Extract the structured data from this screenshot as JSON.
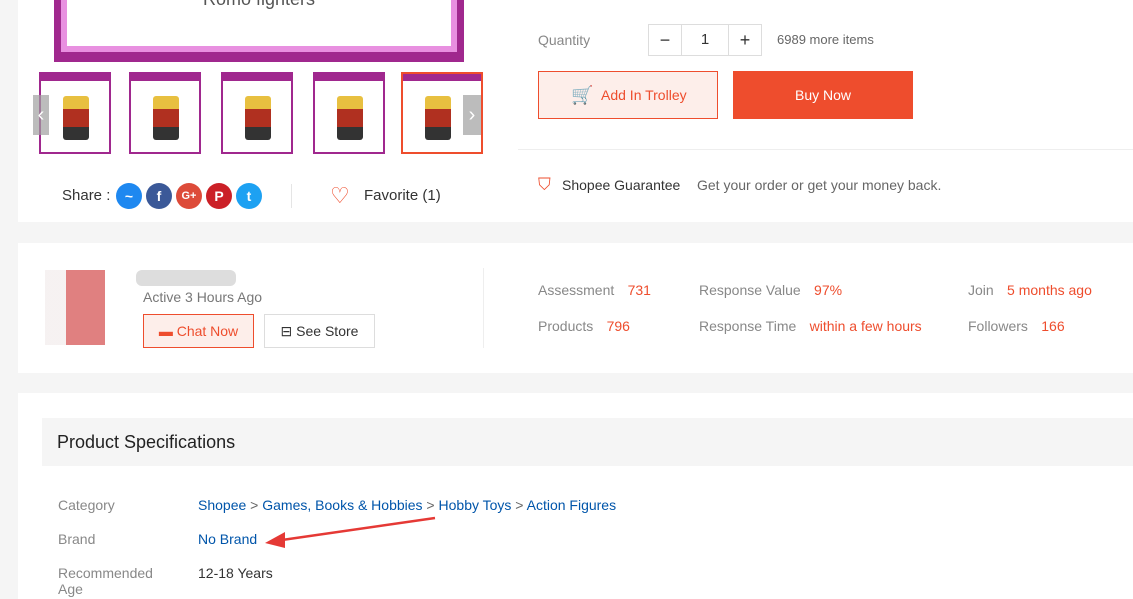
{
  "gallery": {
    "main_caption": "Romo fighters",
    "share_label": "Share :",
    "favorite_label": "Favorite (1)"
  },
  "purchase": {
    "quantity_label": "Quantity",
    "quantity_value": "1",
    "stock": "6989 more items",
    "add_trolley": "Add In Trolley",
    "buy_now": "Buy Now",
    "guarantee_title": "Shopee Guarantee",
    "guarantee_text": "Get your order or get your money back."
  },
  "shop": {
    "active": "Active 3 Hours Ago",
    "chat": "Chat Now",
    "see_store": "See Store",
    "stats": [
      {
        "label": "Assessment",
        "value": "731"
      },
      {
        "label": "Response Value",
        "value": "97%"
      },
      {
        "label": "Join",
        "value": "5 months ago"
      },
      {
        "label": "Products",
        "value": "796"
      },
      {
        "label": "Response Time",
        "value": "within a few hours"
      },
      {
        "label": "Followers",
        "value": "166"
      }
    ]
  },
  "specs": {
    "title": "Product Specifications",
    "category_label": "Category",
    "breadcrumb": [
      "Shopee",
      "Games, Books & Hobbies",
      "Hobby Toys",
      "Action Figures"
    ],
    "brand_label": "Brand",
    "brand_value": "No Brand",
    "age_label": "Recommended Age",
    "age_value": "12-18 Years"
  },
  "colors": {
    "accent": "#ee4d2d",
    "link": "#0055aa",
    "frame": "#a0288e"
  }
}
